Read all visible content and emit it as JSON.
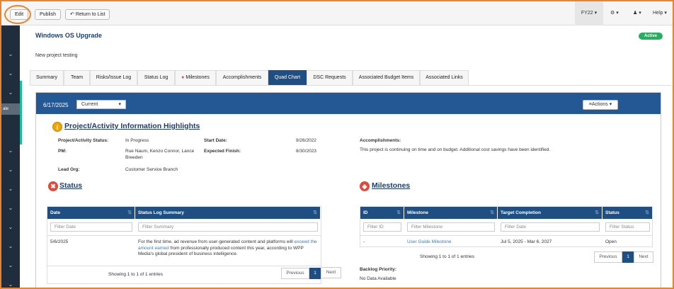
{
  "toolbar": {
    "edit": "Edit",
    "publish": "Publish",
    "return": "Return to List"
  },
  "topnav": {
    "fy": "FY22",
    "help": "Help"
  },
  "sidebar": {
    "highlight_label": "ale"
  },
  "project": {
    "title": "Windows OS Upgrade",
    "status": "Active",
    "description": "New project testing"
  },
  "tabs": [
    "Summary",
    "Team",
    "Risks/Issue Log",
    "Status Log",
    "Milestones",
    "Accomplishments",
    "Quad Chart",
    "DSC Requests",
    "Associated Budget Items",
    "Associated Links"
  ],
  "quad": {
    "date": "6/17/2025",
    "period_select": "Current",
    "actions": "Actions",
    "highlights_title": "Project/Activity Information Highlights",
    "status_label": "Project/Activity Status:",
    "status_value": "In Progress",
    "pm_label": "PM:",
    "pm_value": "Rue Naum, Kenzo Connor, Lance Breeden",
    "lead_org_label": "Lead Org:",
    "lead_org_value": "Customer Service Branch",
    "start_label": "Start Date:",
    "start_value": "9/26/2022",
    "finish_label": "Expected Finish:",
    "finish_value": "8/30/2023",
    "accomplishments_label": "Accomplishments:",
    "accomplishments_value": "This project is continuing on time and on budget. Additional cost savings have been identified."
  },
  "status_section": {
    "title": "Status",
    "columns": [
      "Date",
      "Status Log Summary"
    ],
    "filters": [
      "Filter Date",
      "Filter Summary"
    ],
    "row": {
      "date": "5/6/2025",
      "summary_pre": "For the first time, ad revenue from user-generated content and platforms will ",
      "summary_link": "exceed the amount earned",
      "summary_post": " from professionally produced content this year, according to WPP Media's global president of business intelligence."
    },
    "info": "Showing 1 to 1 of 1 entries",
    "pager": {
      "prev": "Previous",
      "page": "1",
      "next": "Next"
    }
  },
  "milestones_section": {
    "title": "Milestones",
    "columns": [
      "ID",
      "Milestone",
      "Target Completion",
      "Status"
    ],
    "filters": [
      "Filter ID",
      "Filter Milestone",
      "Filter Date",
      "Filter Status"
    ],
    "row": {
      "id": "-",
      "milestone": "User Guide Milestone",
      "target": "Jul 5, 2025 - Mar 6, 2027",
      "status": "Open"
    },
    "info": "Showing 1 to 1 of 1 entries",
    "pager": {
      "prev": "Previous",
      "page": "1",
      "next": "Next"
    },
    "backlog_label": "Backlog Priority:",
    "backlog_value": "No Data Available"
  }
}
